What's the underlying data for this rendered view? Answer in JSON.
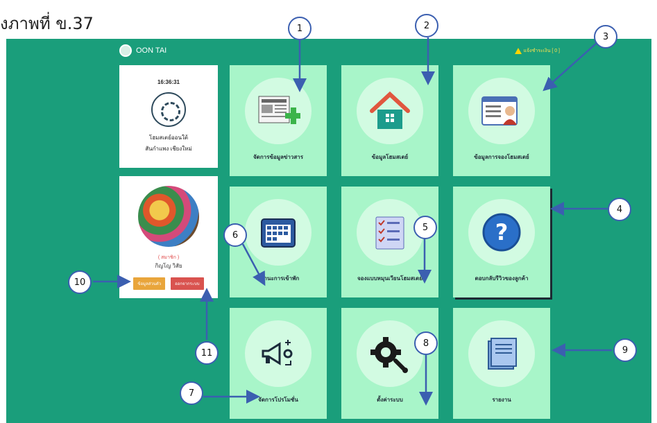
{
  "caption": "ังภาพที่ ข.37",
  "header": {
    "brand": "OON TAI",
    "notify": "แจ้งชำระเงิน [ 0 ]"
  },
  "clock_card": {
    "time": "16:36:31",
    "name_line1": "โฮมสเตย์ออนใต้",
    "name_line2": "สันกำแพง เชียงใหม่"
  },
  "profile": {
    "role": "( สมาชิก )",
    "name": "กิญโญ วิสัย",
    "edit_label": "ข้อมูลส่วนตัว",
    "logout_label": "ออกจากระบบ"
  },
  "tiles": [
    {
      "label": "จัดการข้อมูลข่าวสาร",
      "icon": "newspaper-icon"
    },
    {
      "label": "ข้อมูลโฮมสเตย์",
      "icon": "house-icon"
    },
    {
      "label": "ข้อมูลการจองโฮมสเตย์",
      "icon": "booking-profile-icon"
    },
    {
      "label": "สถานะการเข้าพัก",
      "icon": "calendar-icon"
    },
    {
      "label": "จองแบบหมุนเวียนโฮมสเตย์",
      "icon": "checklist-icon"
    },
    {
      "label": "ตอบกลับรีวิวของลูกค้า",
      "icon": "question-icon"
    },
    {
      "label": "จัดการโปรโมชั่น",
      "icon": "megaphone-icon"
    },
    {
      "label": "ตั้งค่าระบบ",
      "icon": "gear-wrench-icon"
    },
    {
      "label": "รายงาน",
      "icon": "report-book-icon"
    }
  ],
  "callouts": [
    "1",
    "2",
    "3",
    "4",
    "5",
    "6",
    "7",
    "8",
    "9",
    "10",
    "11"
  ],
  "colors": {
    "background": "#1a9e7b",
    "tile": "#a8f5c9",
    "callout_border": "#3b5fb0"
  }
}
